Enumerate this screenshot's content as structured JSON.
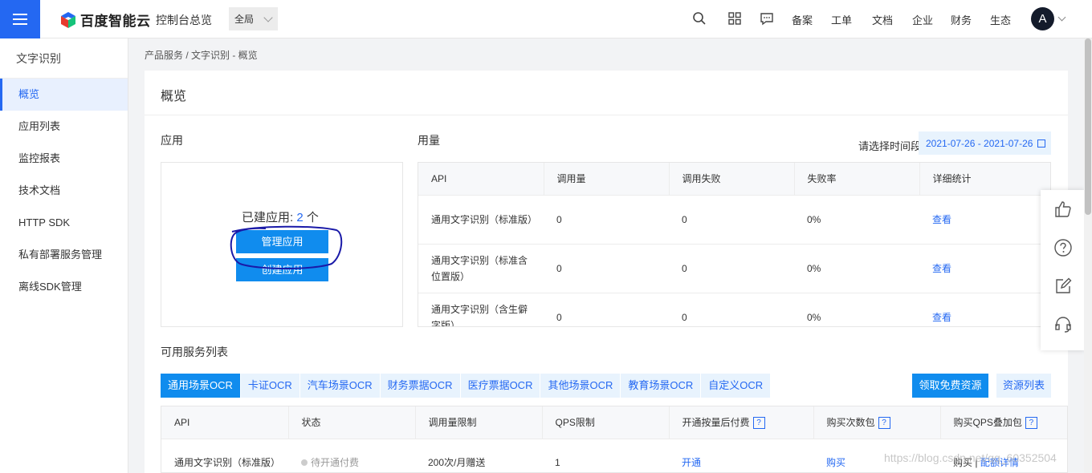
{
  "topbar": {
    "brand": "百度智能云",
    "console": "控制台总览",
    "region": "全局",
    "links": [
      "备案",
      "工单",
      "文档",
      "企业",
      "财务",
      "生态"
    ],
    "avatar_initial": "A"
  },
  "sidebar": {
    "title": "文字识别",
    "items": [
      {
        "label": "概览",
        "active": true
      },
      {
        "label": "应用列表"
      },
      {
        "label": "监控报表"
      },
      {
        "label": "技术文档"
      },
      {
        "label": "HTTP SDK"
      },
      {
        "label": "私有部署服务管理"
      },
      {
        "label": "离线SDK管理"
      }
    ]
  },
  "breadcrumb": "产品服务 / 文字识别 - 概览",
  "page_title": "概览",
  "apps": {
    "title": "应用",
    "created_label": "已建应用: ",
    "count": "2",
    "unit": " 个",
    "manage_label": "管理应用",
    "create_label": "创建应用"
  },
  "usage": {
    "title": "用量",
    "date_label": "请选择时间段",
    "date_range": "2021-07-26 - 2021-07-26",
    "headers": [
      "API",
      "调用量",
      "调用失败",
      "失败率",
      "详细统计"
    ],
    "rows": [
      {
        "api": "通用文字识别（标准版）",
        "calls": "0",
        "failed": "0",
        "rate": "0%",
        "detail": "查看"
      },
      {
        "api": "通用文字识别（标准含位置版）",
        "calls": "0",
        "failed": "0",
        "rate": "0%",
        "detail": "查看"
      },
      {
        "api": "通用文字识别（含生僻字版）",
        "calls": "0",
        "failed": "0",
        "rate": "0%",
        "detail": "查看"
      }
    ]
  },
  "services": {
    "title": "可用服务列表",
    "tabs": [
      "通用场景OCR",
      "卡证OCR",
      "汽车场景OCR",
      "财务票据OCR",
      "医疗票据OCR",
      "其他场景OCR",
      "教育场景OCR",
      "自定义OCR"
    ],
    "free_button": "领取免费资源",
    "resource_button": "资源列表",
    "headers": [
      "API",
      "状态",
      "调用量限制",
      "QPS限制",
      "开通按量后付费",
      "购买次数包",
      "购买QPS叠加包"
    ],
    "help_mark": "?",
    "rows": [
      {
        "api": "通用文字识别（标准版）",
        "status": "待开通付费",
        "limit": "200次/月赠送",
        "qps": "1",
        "open": "开通",
        "buy": "购买",
        "buy_qps": "购买",
        "sep": " | ",
        "quota": "配额详情"
      }
    ]
  },
  "watermark": "https://blog.csdn.net/qq_60352504"
}
